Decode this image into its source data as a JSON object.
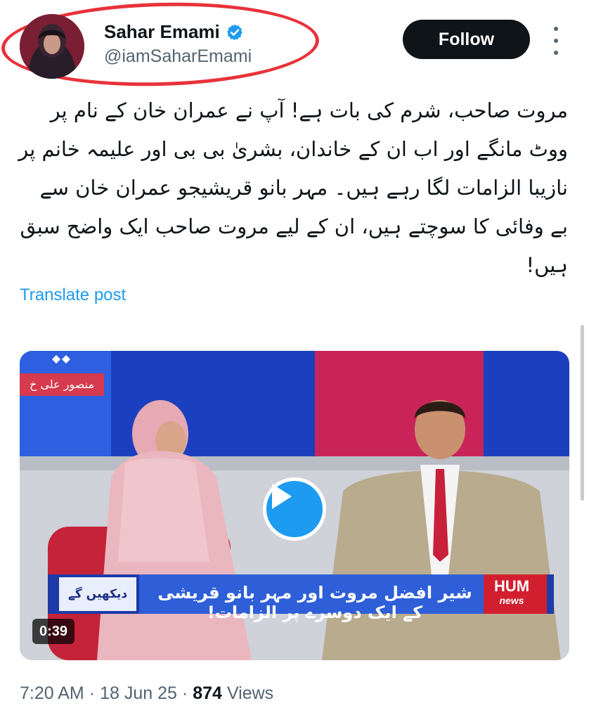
{
  "author": {
    "display_name": "Sahar Emami",
    "handle": "@iamSaharEmami",
    "verified": true,
    "verified_icon": "verified-badge-icon",
    "avatar_icon": "profile-avatar"
  },
  "follow": {
    "label": "Follow"
  },
  "more_menu_icon": "more-vertical-icon",
  "post": {
    "text": "مروت صاحب، شرم کی بات ہے! آپ نے عمران خان کے نام پر ووٹ مانگے اور اب ان کے خاندان، بشریٰ بی بی اور علیمہ خانم پر نازیبا الزامات لگا رہے ہیں۔ مہر بانو قریشیجو عمران خان سے بے وفائی کا سوچتے ہیں، ان کے لیے مروت صاحب ایک واضح سبق ہیں!",
    "translate_label": "Translate post"
  },
  "video": {
    "duration": "0:39",
    "play_icon": "play-icon",
    "ticker_text": "شیر افضل مروت اور مہر بانو قریشی کے ایک دوسرے پر الزامات!",
    "ticker_badge": "دیکھیں گے",
    "corner_tag": "منصور علی خ",
    "channel_logo": {
      "line1": "HUM",
      "line2": "news"
    }
  },
  "meta": {
    "time": "7:20 AM",
    "separator": "·",
    "date": "18 Jun 25",
    "views_count": "874",
    "views_label": "Views"
  },
  "colors": {
    "accent": "#1d9bf0",
    "text": "#0f1419",
    "secondary": "#536471",
    "highlight_ring": "#e8323a",
    "follow_bg": "#0f1419"
  }
}
